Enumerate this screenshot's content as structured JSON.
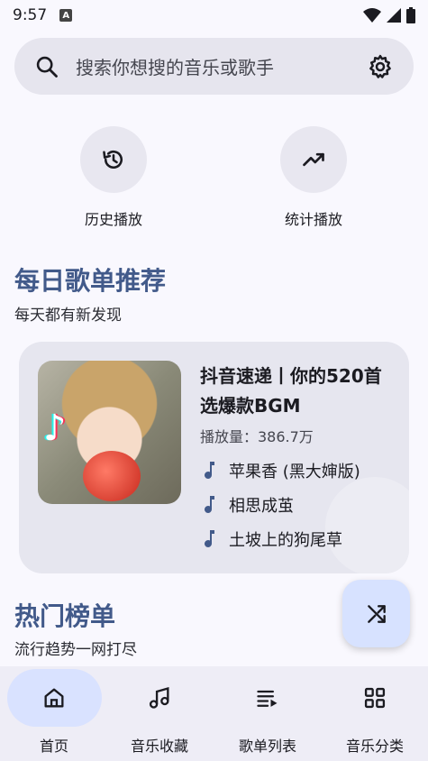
{
  "status": {
    "time": "9:57",
    "badge": "A"
  },
  "search": {
    "placeholder": "搜索你想搜的音乐或歌手",
    "icon": "search-icon",
    "settings_icon": "gear-icon"
  },
  "quick_actions": [
    {
      "label": "历史播放",
      "icon": "history-icon"
    },
    {
      "label": "统计播放",
      "icon": "trending-up-icon"
    }
  ],
  "daily": {
    "title": "每日歌单推荐",
    "subtitle": "每天都有新发现",
    "playlist": {
      "title": "抖音速递丨你的520首选爆款BGM",
      "plays": "播放量：386.7万",
      "songs": [
        "苹果香 (黑大婶版)",
        "相思成茧",
        "土坡上的狗尾草"
      ]
    }
  },
  "hot": {
    "title": "热门榜单",
    "subtitle": "流行趋势一网打尽"
  },
  "fab": {
    "icon": "shuffle-icon"
  },
  "nav": [
    {
      "label": "首页",
      "icon": "home-icon",
      "active": true
    },
    {
      "label": "音乐收藏",
      "icon": "music-note-icon",
      "active": false
    },
    {
      "label": "歌单列表",
      "icon": "playlist-icon",
      "active": false
    },
    {
      "label": "音乐分类",
      "icon": "grid-icon",
      "active": false
    }
  ],
  "colors": {
    "accent": "#425a8a",
    "active_pill": "#d9e2ff",
    "surface": "#e6e6ef"
  }
}
